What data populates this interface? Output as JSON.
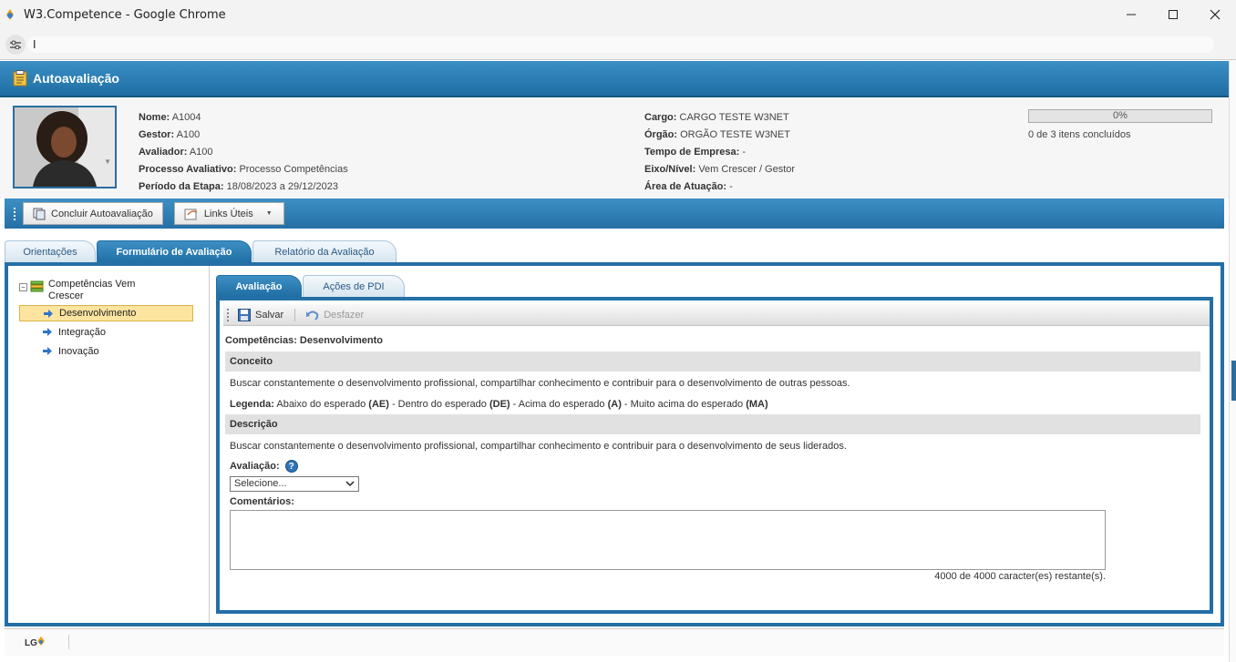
{
  "window": {
    "title": "W3.Competence - Google Chrome",
    "url": "I"
  },
  "header": {
    "title": "Autoavaliação"
  },
  "employee": {
    "fields_left": [
      {
        "label": "Nome:",
        "value": "A1004"
      },
      {
        "label": "Gestor:",
        "value": "A100"
      },
      {
        "label": "Avaliador:",
        "value": "A100"
      },
      {
        "label": "Processo Avaliativo:",
        "value": "Processo Competências"
      },
      {
        "label": "Período da Etapa:",
        "value": "18/08/2023 a 29/12/2023"
      }
    ],
    "fields_right": [
      {
        "label": "Cargo:",
        "value": "CARGO TESTE W3NET"
      },
      {
        "label": "Órgão:",
        "value": "ORGÃO TESTE W3NET"
      },
      {
        "label": "Tempo de Empresa:",
        "value": "-"
      },
      {
        "label": "Eixo/Nível:",
        "value": "Vem Crescer / Gestor"
      },
      {
        "label": "Área de Atuação:",
        "value": "-"
      }
    ],
    "progress_percent": "0%",
    "progress_value": 0,
    "progress_text": "0 de 3 itens concluídos"
  },
  "toolbar": {
    "conclude_label": "Concluir Autoavaliação",
    "links_label": "Links Úteis"
  },
  "tabs": [
    {
      "label": "Orientações"
    },
    {
      "label": "Formulário de Avaliação"
    },
    {
      "label": "Relatório da Avaliação"
    }
  ],
  "tree": {
    "root": "Competências Vem Crescer",
    "items": [
      {
        "label": "Desenvolvimento"
      },
      {
        "label": "Integração"
      },
      {
        "label": "Inovação"
      }
    ]
  },
  "subtabs": [
    {
      "label": "Avaliação"
    },
    {
      "label": "Ações de PDI"
    }
  ],
  "inner_toolbar": {
    "save_label": "Salvar",
    "undo_label": "Desfazer"
  },
  "form": {
    "competency_title": "Competências: Desenvolvimento",
    "concept_heading": "Conceito",
    "concept_text": "Buscar constantemente o desenvolvimento profissional, compartilhar conhecimento e contribuir para o desenvolvimento de outras pessoas.",
    "legend_label": "Legenda:",
    "legend_parts": [
      {
        "text": "Abaixo do esperado",
        "code": "(AE)"
      },
      {
        "text": "Dentro do esperado",
        "code": "(DE)"
      },
      {
        "text": "Acima do esperado",
        "code": "(A)"
      },
      {
        "text": "Muito acima do esperado",
        "code": "(MA)"
      }
    ],
    "description_heading": "Descrição",
    "description_text": "Buscar constantemente o desenvolvimento profissional, compartilhar conhecimento e contribuir para o desenvolvimento de seus liderados.",
    "evaluation_label": "Avaliação:",
    "help_glyph": "?",
    "evaluation_selected": "Selecione...",
    "comments_label": "Comentários:",
    "comments_value": "",
    "char_counter": "4000 de 4000 caracter(es) restante(s)."
  },
  "footer": {
    "logo": "LG"
  },
  "colors": {
    "brand_blue": "#246fa6",
    "selected_item": "#fde5a0"
  }
}
